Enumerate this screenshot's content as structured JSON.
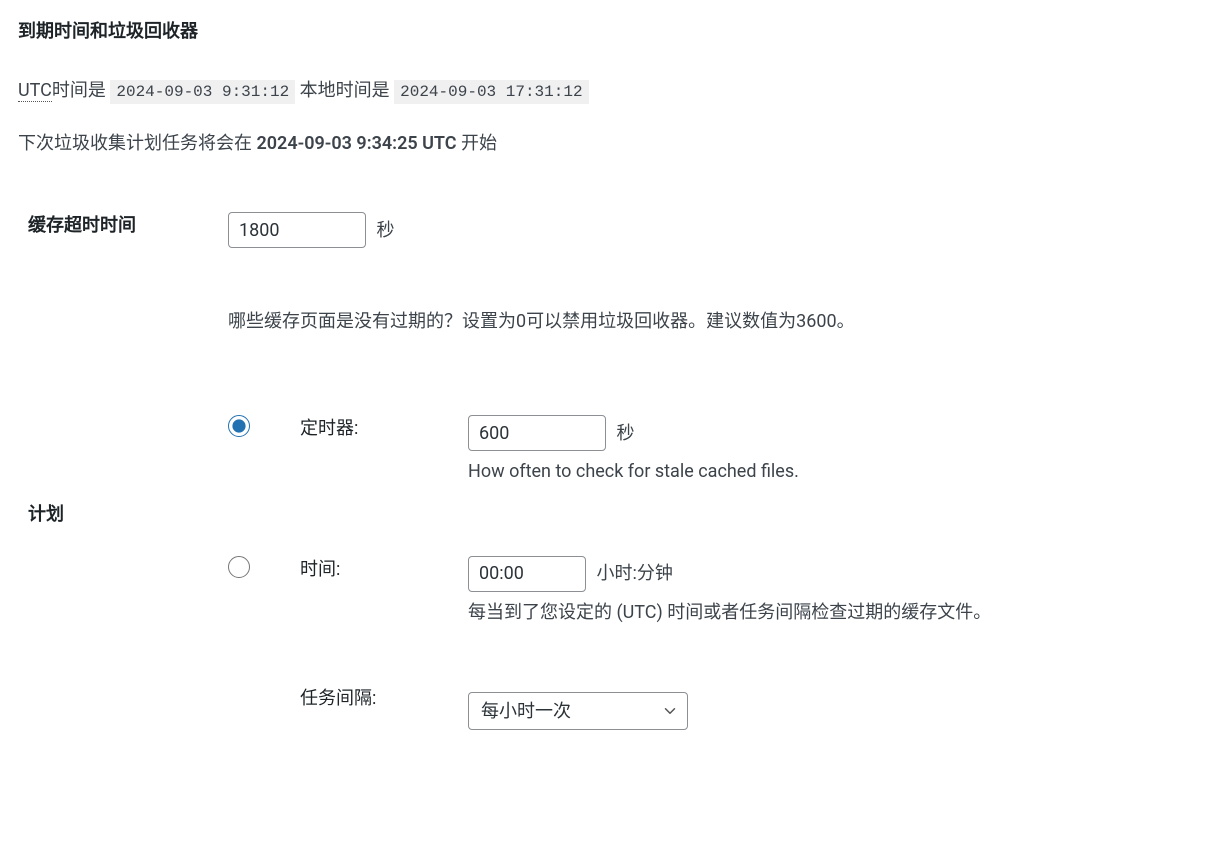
{
  "heading": "到期时间和垃圾回收器",
  "times": {
    "utc_label": "UTC",
    "utc_suffix": "时间是",
    "utc_value": "2024-09-03 9:31:12",
    "local_prefix": "本地时间是",
    "local_value": "2024-09-03 17:31:12"
  },
  "next_gc": {
    "prefix": "下次垃圾收集计划任务将会在",
    "time": "2024-09-03 9:34:25 UTC",
    "suffix": "开始"
  },
  "cache_timeout": {
    "label": "缓存超时时间",
    "value": "1800",
    "unit": "秒",
    "help": "哪些缓存页面是没有过期的？设置为0可以禁用垃圾回收器。建议数值为3600。"
  },
  "schedule": {
    "label": "计划",
    "options": {
      "timer": {
        "label": "定时器:",
        "value": "600",
        "unit": "秒",
        "desc": "How often to check for stale cached files."
      },
      "time": {
        "label": "时间:",
        "value": "00:00",
        "unit": "小时:分钟",
        "desc": "每当到了您设定的 (UTC) 时间或者任务间隔检查过期的缓存文件。"
      },
      "interval": {
        "label": "任务间隔:",
        "selected": "每小时一次"
      }
    }
  }
}
